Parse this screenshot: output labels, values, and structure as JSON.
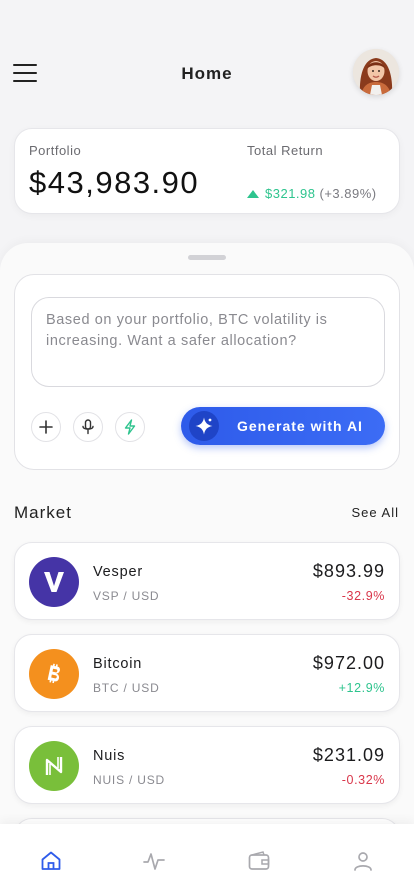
{
  "header": {
    "title": "Home",
    "menu_icon": "hamburger-menu-icon",
    "avatar": "user-avatar"
  },
  "portfolio": {
    "label": "Portfolio",
    "value": "$43,983.90",
    "return_label": "Total Return",
    "return_amount": "$321.98",
    "return_percent": "(+3.89%)",
    "return_direction": "up"
  },
  "ai_panel": {
    "input_placeholder": "Based on your portfolio, BTC volatility is increasing. Want a safer allocation?",
    "tools": [
      "plus-icon",
      "microphone-icon",
      "lightning-icon"
    ],
    "generate_label": "Generate with AI",
    "generate_icon": "sparkle-icon"
  },
  "market": {
    "title": "Market",
    "see_all_label": "See All",
    "items": [
      {
        "name": "Vesper",
        "pair": "VSP / USD",
        "price": "$893.99",
        "change": "-32.9%",
        "trend": "down",
        "logo_color": "#4534a6",
        "logo_icon": "vesper-logo-icon"
      },
      {
        "name": "Bitcoin",
        "pair": "BTC / USD",
        "price": "$972.00",
        "change": "+12.9%",
        "trend": "up",
        "logo_color": "#f4901e",
        "logo_icon": "bitcoin-logo-icon"
      },
      {
        "name": "Nuis",
        "pair": "NUIS / USD",
        "price": "$231.09",
        "change": "-0.32%",
        "trend": "down",
        "logo_color": "#79bf3a",
        "logo_icon": "nuis-logo-icon"
      }
    ]
  },
  "colors": {
    "accent": "#2e5bea",
    "positive": "#2ec48e",
    "negative": "#d9364a"
  },
  "tabbar": {
    "items": [
      "home-icon",
      "activity-icon",
      "wallet-icon",
      "profile-icon"
    ],
    "active": "home-icon"
  }
}
